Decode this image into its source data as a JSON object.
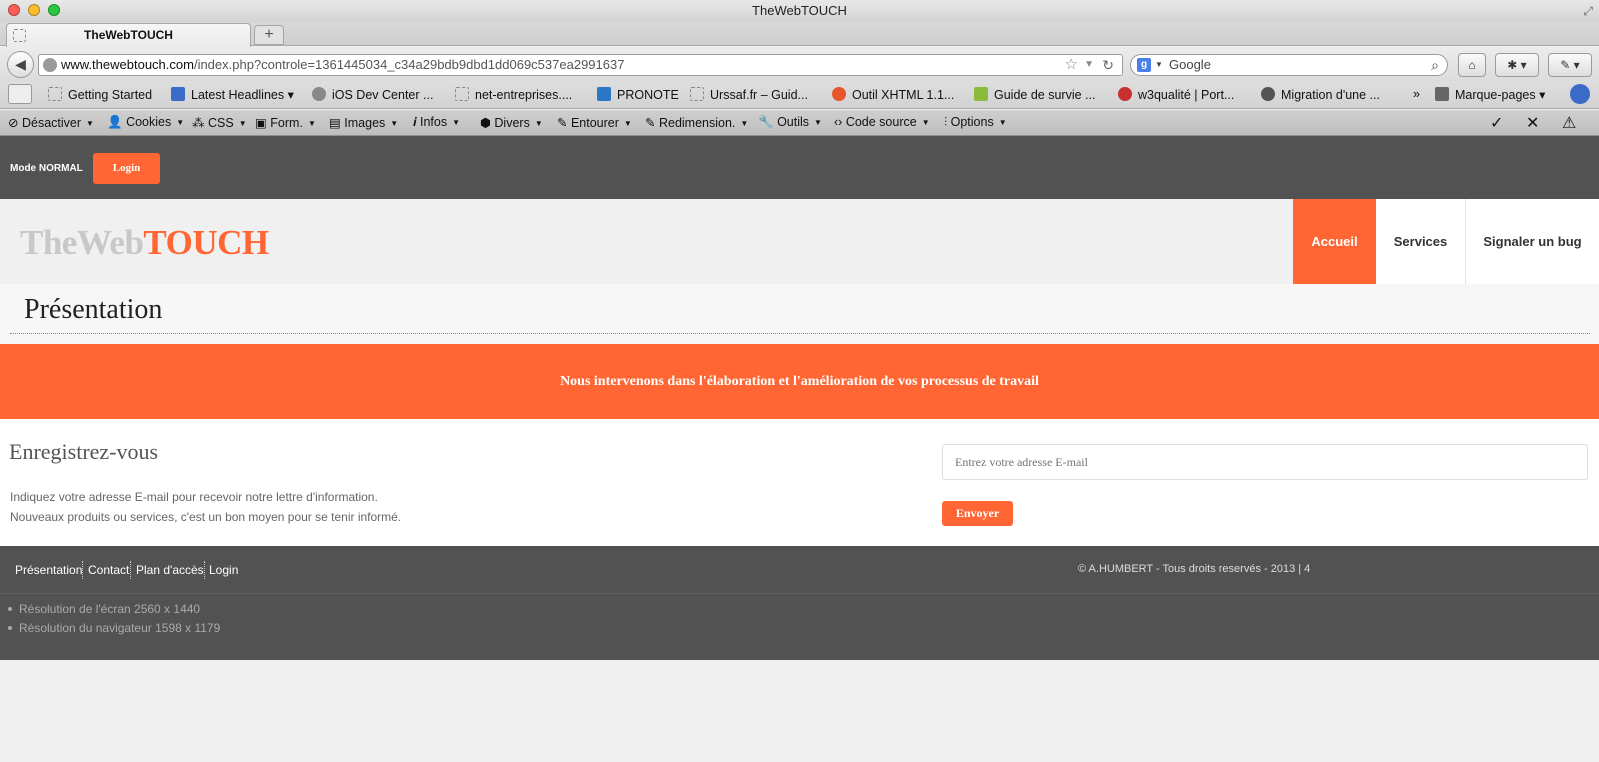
{
  "window": {
    "title": "TheWebTOUCH"
  },
  "tab": {
    "label": "TheWebTOUCH",
    "new_tab": "+"
  },
  "address": {
    "host": "www.thewebtouch.com",
    "path": "/index.php?controle=1361445034_c34a29bdb9dbd1dd069c537ea2991637"
  },
  "search": {
    "placeholder": "Google"
  },
  "bookmarks": [
    "Getting Started",
    "Latest Headlines",
    "iOS Dev Center ...",
    "net-entreprises....",
    "PRONOTE",
    "Urssaf.fr – Guid...",
    "Outil XHTML 1.1...",
    "Guide de survie ...",
    "w3qualité | Port...",
    "Migration d'une ...",
    "Marque-pages"
  ],
  "devtools": [
    "Désactiver",
    "Cookies",
    "CSS",
    "Form.",
    "Images",
    "Infos",
    "Divers",
    "Entourer",
    "Redimension.",
    "Outils",
    "Code source",
    "Options"
  ],
  "topbar": {
    "mode": "Mode NORMAL",
    "login": "Login"
  },
  "logo": {
    "part1": "TheWeb",
    "part2": "TOUCH"
  },
  "menu": {
    "home": "Accueil",
    "services": "Services",
    "bug": "Signaler un bug"
  },
  "page_title": "Présentation",
  "banner": "Nous intervenons dans l'élaboration et l'amélioration de vos processus de travail",
  "register": {
    "title": "Enregistrez-vous",
    "line1": "Indiquez votre adresse E-mail pour recevoir notre lettre d'information.",
    "line2": "Nouveaux produits ou services, c'est un bon moyen pour se tenir informé.",
    "email_placeholder": "Entrez votre adresse E-mail",
    "send": "Envoyer"
  },
  "footer": {
    "links": [
      "Présentation",
      "Contact",
      "Plan d'accès",
      "Login"
    ],
    "copyright": "© A.HUMBERT - Tous droits reservés - 2013 | 4",
    "screen_res": "Résolution de l'écran 2560 x 1440",
    "browser_res": "Résolution du navigateur 1598 x 1179"
  },
  "colors": {
    "accent": "#ff6633",
    "dark": "#525252"
  }
}
